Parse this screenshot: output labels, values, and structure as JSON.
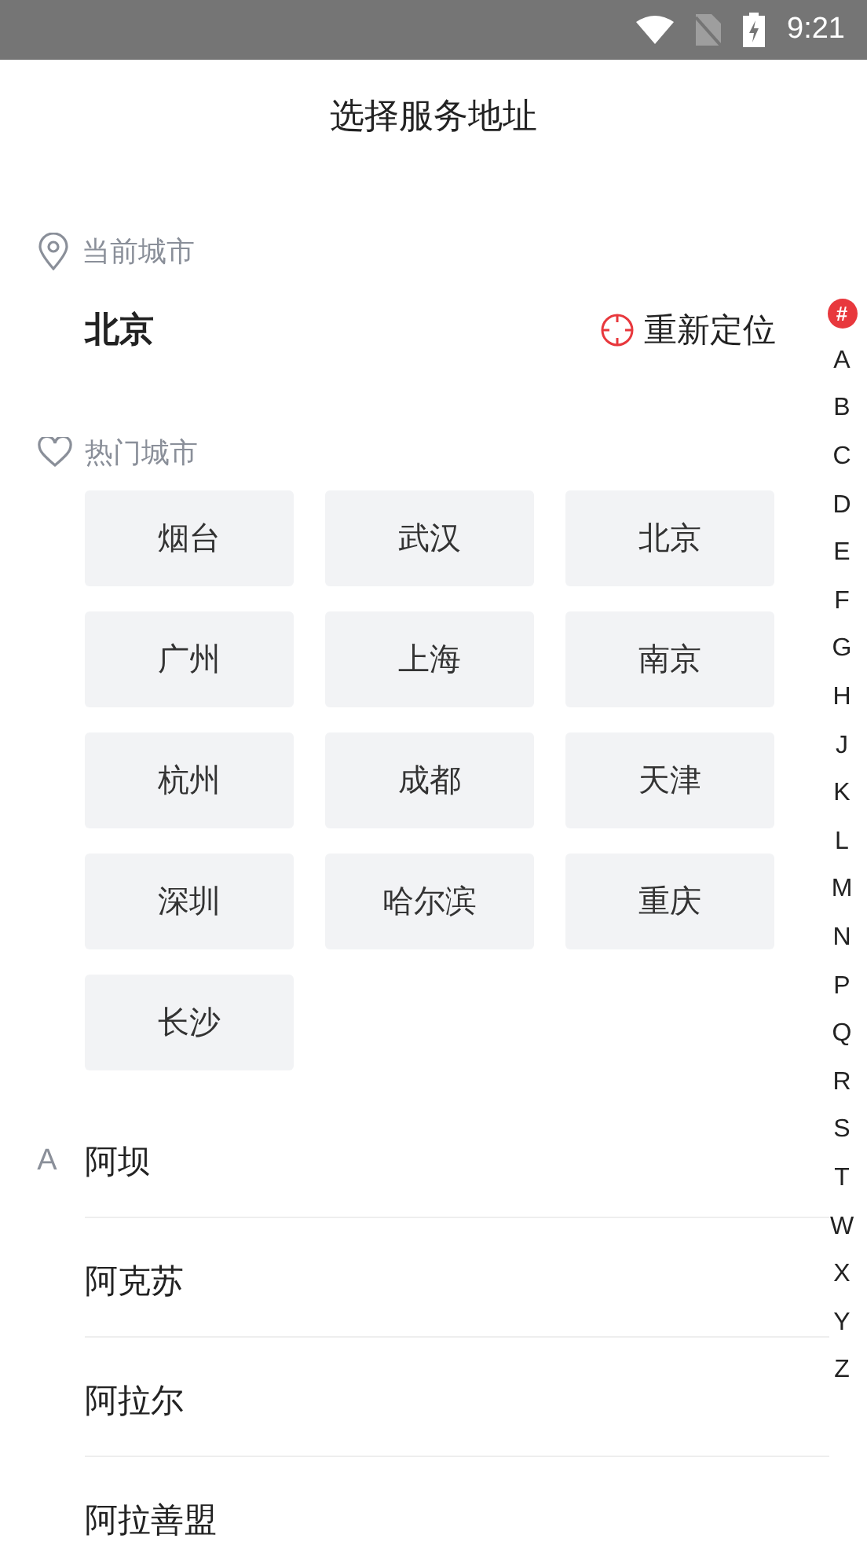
{
  "status_bar": {
    "time": "9:21"
  },
  "title": "选择服务地址",
  "current_city": {
    "label": "当前城市",
    "city": "北京",
    "relocate": "重新定位"
  },
  "hot_cities": {
    "label": "热门城市",
    "items": [
      "烟台",
      "武汉",
      "北京",
      "广州",
      "上海",
      "南京",
      "杭州",
      "成都",
      "天津",
      "深圳",
      "哈尔滨",
      "重庆",
      "长沙"
    ]
  },
  "city_list": [
    {
      "letter": "A",
      "cities": [
        "阿坝",
        "阿克苏",
        "阿拉尔",
        "阿拉善盟"
      ]
    }
  ],
  "index_bar": [
    {
      "label": "#",
      "selected": true
    },
    {
      "label": "A",
      "selected": false
    },
    {
      "label": "B",
      "selected": false
    },
    {
      "label": "C",
      "selected": false
    },
    {
      "label": "D",
      "selected": false
    },
    {
      "label": "E",
      "selected": false
    },
    {
      "label": "F",
      "selected": false
    },
    {
      "label": "G",
      "selected": false
    },
    {
      "label": "H",
      "selected": false
    },
    {
      "label": "J",
      "selected": false
    },
    {
      "label": "K",
      "selected": false
    },
    {
      "label": "L",
      "selected": false
    },
    {
      "label": "M",
      "selected": false
    },
    {
      "label": "N",
      "selected": false
    },
    {
      "label": "P",
      "selected": false
    },
    {
      "label": "Q",
      "selected": false
    },
    {
      "label": "R",
      "selected": false
    },
    {
      "label": "S",
      "selected": false
    },
    {
      "label": "T",
      "selected": false
    },
    {
      "label": "W",
      "selected": false
    },
    {
      "label": "X",
      "selected": false
    },
    {
      "label": "Y",
      "selected": false
    },
    {
      "label": "Z",
      "selected": false
    }
  ]
}
